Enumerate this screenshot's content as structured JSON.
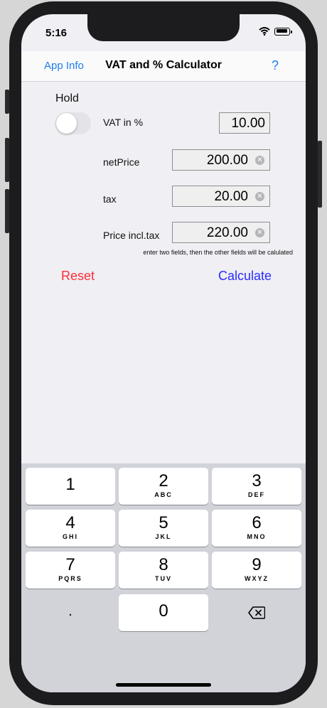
{
  "status": {
    "time": "5:16"
  },
  "nav": {
    "left": "App Info",
    "title": "VAT and % Calculator",
    "right": "?"
  },
  "form": {
    "hold_label": "Hold",
    "hold_on": false,
    "vat_label": "VAT in %",
    "vat_value": "10.00",
    "net_label": "netPrice",
    "net_value": "200.00",
    "tax_label": "tax",
    "tax_value": "20.00",
    "gross_label": "Price incl.tax",
    "gross_value": "220.00",
    "hint": "enter two fields, then the other fields will be calulated"
  },
  "actions": {
    "reset": "Reset",
    "calculate": "Calculate"
  },
  "keyboard": {
    "keys": [
      {
        "num": "1",
        "sub": ""
      },
      {
        "num": "2",
        "sub": "ABC"
      },
      {
        "num": "3",
        "sub": "DEF"
      },
      {
        "num": "4",
        "sub": "GHI"
      },
      {
        "num": "5",
        "sub": "JKL"
      },
      {
        "num": "6",
        "sub": "MNO"
      },
      {
        "num": "7",
        "sub": "PQRS"
      },
      {
        "num": "8",
        "sub": "TUV"
      },
      {
        "num": "9",
        "sub": "WXYZ"
      },
      {
        "num": ".",
        "sub": ""
      },
      {
        "num": "0",
        "sub": ""
      }
    ],
    "delete_icon": "backspace-icon"
  },
  "colors": {
    "link": "#1e7cf2",
    "reset": "#ff2d38",
    "calculate": "#2b2bff"
  }
}
